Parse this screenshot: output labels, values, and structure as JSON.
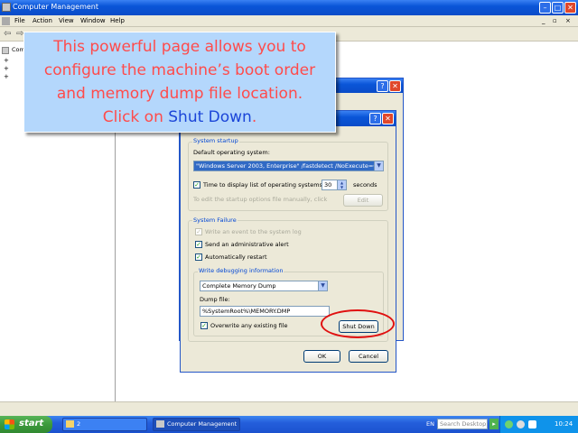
{
  "window": {
    "title": "Computer Management"
  },
  "menu": [
    "File",
    "Action",
    "View",
    "Window",
    "Help"
  ],
  "tree": {
    "first_item": "Comp"
  },
  "tooltip": {
    "line1": "This powerful page allows you to",
    "line2": "configure the machine’s boot order",
    "line3": "and memory dump file location.",
    "line4_prefix": "Click on ",
    "line4_highlight": "Shut Down",
    "line4_suffix": "."
  },
  "dialog": {
    "system_startup": {
      "group_label": "System startup",
      "default_os_label": "Default operating system:",
      "default_os_value": "\"Windows Server 2003, Enterprise\" /fastdetect /NoExecute=OptO",
      "time_label": "Time to display list of operating systems:",
      "time_value": "30",
      "time_unit": "seconds",
      "edit_hint": "To edit the startup options file manually, click Edit.",
      "edit_button": "Edit"
    },
    "system_failure": {
      "group_label": "System Failure",
      "write_event": "Write an event to the system log",
      "send_alert": "Send an administrative alert",
      "auto_restart": "Automatically restart"
    },
    "debug": {
      "group_label": "Write debugging information",
      "dump_type": "Complete Memory Dump",
      "dump_file_label": "Dump file:",
      "dump_file_value": "%SystemRoot%\\MEMORY.DMP",
      "overwrite": "Overwrite any existing file",
      "shutdown_button": "Shut Down"
    },
    "ok_button": "OK",
    "cancel_button": "Cancel"
  },
  "taskbar": {
    "start": "start",
    "task1": "2",
    "task2": "Computer Management",
    "lang": "EN",
    "search_placeholder": "Search Desktop",
    "clock": "10:24"
  },
  "colors": {
    "highlight_ellipse": "#e01010",
    "tooltip_text": "#ff4b4b",
    "tooltip_highlight": "#1b45d8"
  }
}
